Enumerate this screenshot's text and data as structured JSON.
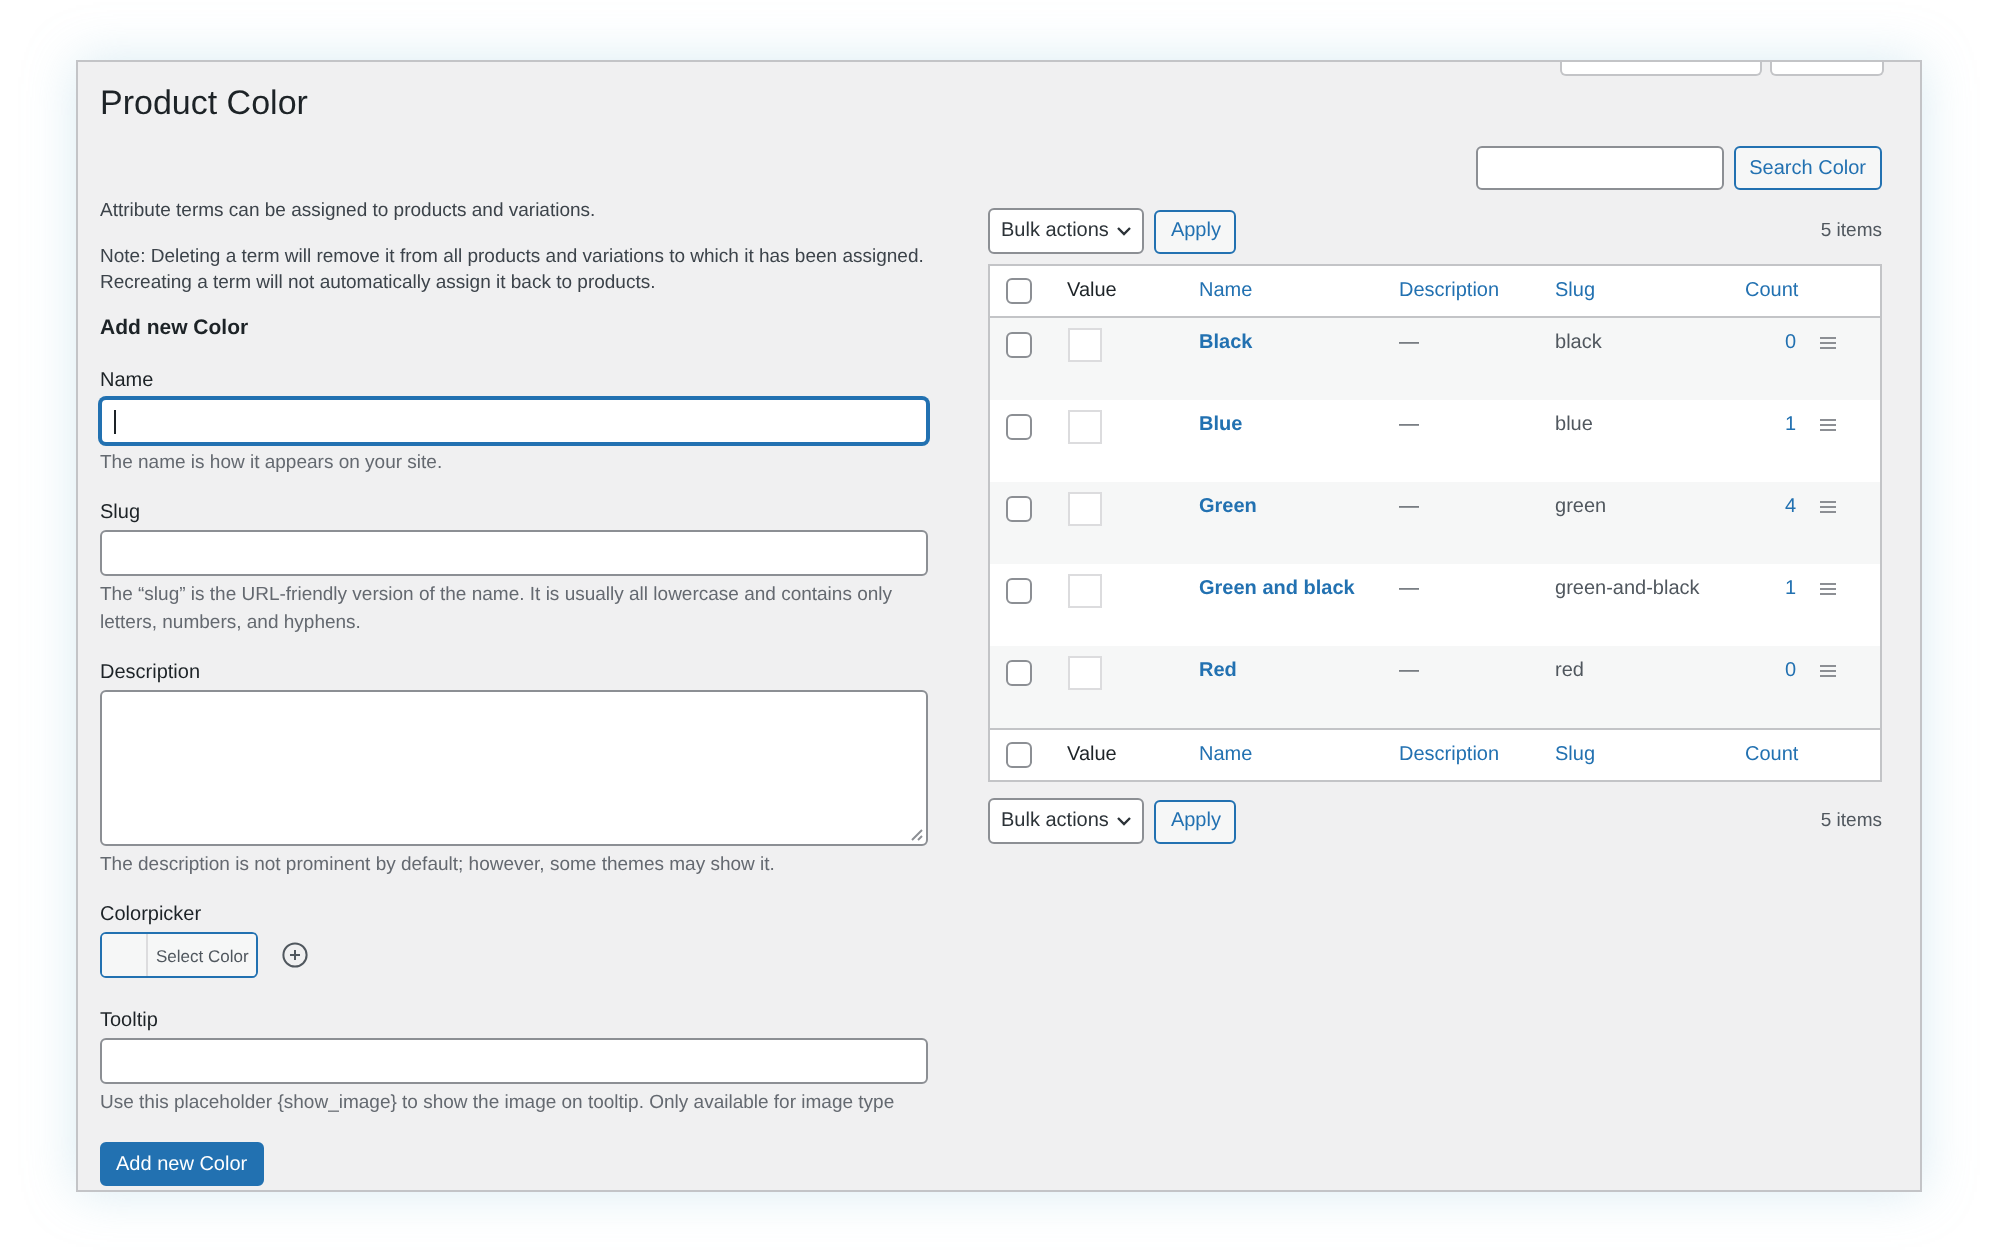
{
  "page": {
    "title": "Product Color"
  },
  "form": {
    "intro": "Attribute terms can be assigned to products and variations.",
    "note": "Note: Deleting a term will remove it from all products and variations to which it has been assigned. Recreating a term will not automatically assign it back to products.",
    "heading": "Add new Color",
    "fields": [
      {
        "kind": "text",
        "label": "Name",
        "focused": true,
        "help": "The name is how it appears on your site."
      },
      {
        "kind": "text",
        "label": "Slug",
        "focused": false,
        "help": "The “slug” is the URL-friendly version of the name. It is usually all lowercase and contains only letters, numbers, and hyphens."
      },
      {
        "kind": "textarea",
        "label": "Description",
        "focused": false,
        "help": "The description is not prominent by default; however, some themes may show it."
      },
      {
        "kind": "color",
        "label": "Colorpicker",
        "button": "Select Color"
      },
      {
        "kind": "text",
        "label": "Tooltip",
        "focused": false,
        "help": "Use this placeholder {show_image} to show the image on tooltip. Only available for image type"
      }
    ],
    "submit": "Add new Color"
  },
  "search": {
    "button": "Search Color"
  },
  "table": {
    "top_nav": {
      "select": "Bulk actions",
      "apply": "Apply",
      "count": "5 items"
    },
    "select_all_checked": false,
    "columns": [
      {
        "label": "Value",
        "sortable": false
      },
      {
        "label": "Name",
        "sortable": true
      },
      {
        "label": "Description",
        "sortable": true
      },
      {
        "label": "Slug",
        "sortable": true
      },
      {
        "label": "Count",
        "sortable": true
      }
    ],
    "rows": [
      {
        "name": "Black",
        "description": "—",
        "slug": "black",
        "count": "0",
        "checked": false
      },
      {
        "name": "Blue",
        "description": "—",
        "slug": "blue",
        "count": "1",
        "checked": false
      },
      {
        "name": "Green",
        "description": "—",
        "slug": "green",
        "count": "4",
        "checked": false
      },
      {
        "name": "Green and black",
        "description": "—",
        "slug": "green-and-black",
        "count": "1",
        "checked": false
      },
      {
        "name": "Red",
        "description": "—",
        "slug": "red",
        "count": "0",
        "checked": false
      }
    ],
    "footer_columns": [
      {
        "label": "Value",
        "sortable": false
      },
      {
        "label": "Name",
        "sortable": true
      },
      {
        "label": "Description",
        "sortable": true
      },
      {
        "label": "Slug",
        "sortable": true
      },
      {
        "label": "Count",
        "sortable": true
      }
    ],
    "bottom_nav": {
      "select": "Bulk actions",
      "apply": "Apply",
      "count": "5 items"
    }
  }
}
